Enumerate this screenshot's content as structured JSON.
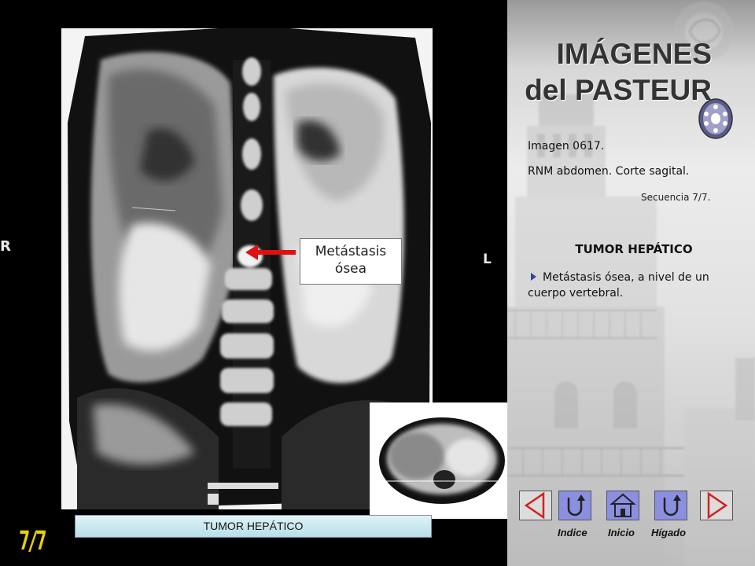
{
  "viewer": {
    "side_left": "R",
    "side_right": "L",
    "callout": {
      "line1": "Metástasis",
      "line2": "ósea"
    },
    "caption": "TUMOR  HEPÁTICO",
    "page_counter": "7/7"
  },
  "panel": {
    "title_line1": "IMÁGENES",
    "title_line2": "del PASTEUR",
    "image_id": "Imagen 0617.",
    "study": "RNM abdomen. Corte sagital.",
    "sequence": "Secuencia   7/7.",
    "topic": "TUMOR HEPÁTICO",
    "finding": "Metástasis ósea, a nivel de un cuerpo vertebral."
  },
  "nav": {
    "prev_icon": "triangle-left-icon",
    "next_icon": "triangle-right-icon",
    "indice_label": "Indice",
    "inicio_label": "Inicio",
    "higado_label": "Hígado",
    "button_color": "#8a8fe0",
    "arrow_button_color": "#dcdcdc",
    "arrow_color": "#d42020"
  },
  "colors": {
    "accent_yellow": "#e8d000",
    "caption_bg": "#cdebf0",
    "callout_arrow": "#e01010"
  }
}
